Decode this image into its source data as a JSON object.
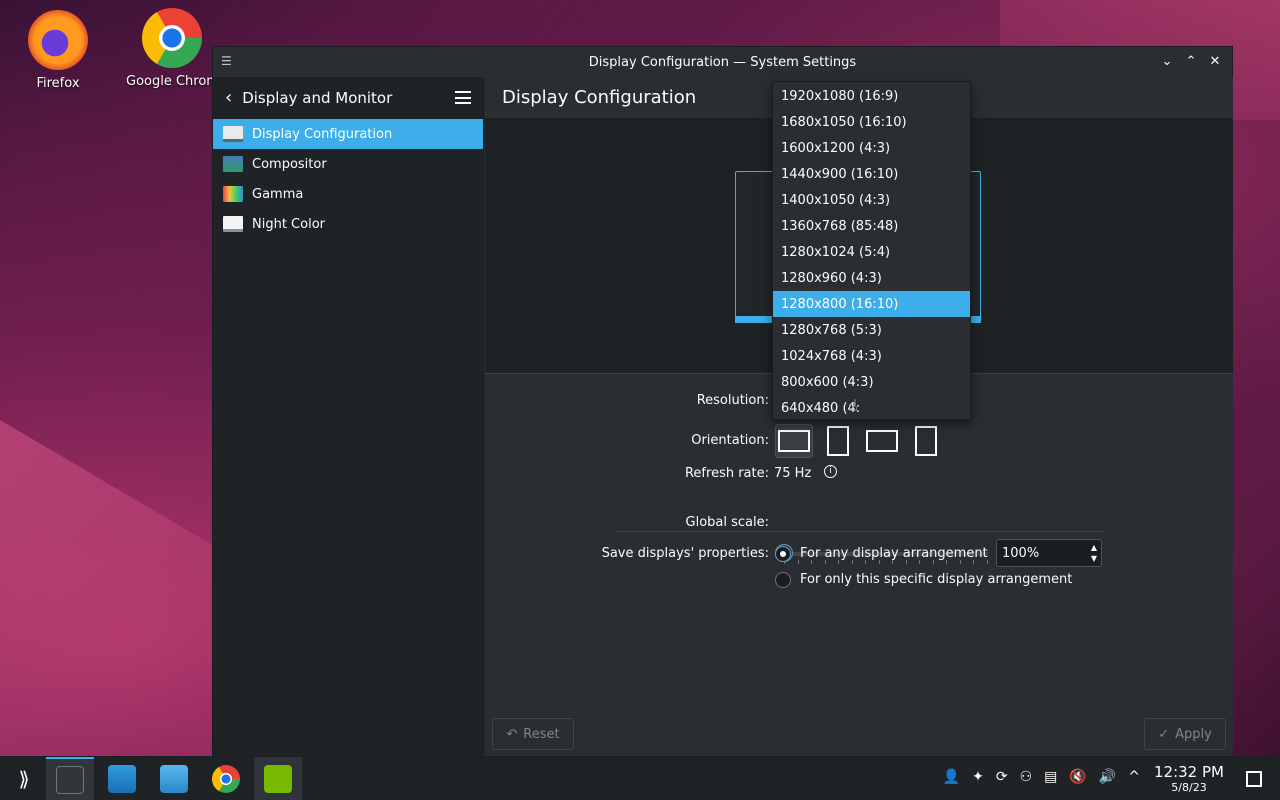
{
  "desktop": {
    "icons": [
      {
        "label": "Firefox"
      },
      {
        "label": "Google Chrome"
      }
    ]
  },
  "window": {
    "title": "Display Configuration — System Settings",
    "sidebar": {
      "header": "Display and Monitor",
      "items": [
        {
          "label": "Display Configuration",
          "icon": "display-icon",
          "active": true
        },
        {
          "label": "Compositor",
          "icon": "compositor-icon"
        },
        {
          "label": "Gamma",
          "icon": "gamma-icon"
        },
        {
          "label": "Night Color",
          "icon": "night-color-icon"
        }
      ]
    },
    "main": {
      "title": "Display Configuration",
      "resolution_label": "Resolution:",
      "orientation_label": "Orientation:",
      "refresh_label": "Refresh rate:",
      "refresh_value": "75 Hz",
      "global_scale_label": "Global scale:",
      "global_scale_value": "100%",
      "save_props_label": "Save displays' properties:",
      "save_options": [
        {
          "label": "For any display arrangement",
          "checked": true
        },
        {
          "label": "For only this specific display arrangement",
          "checked": false
        }
      ],
      "reset_label": "Reset",
      "apply_label": "Apply"
    },
    "resolution_dropdown": {
      "selected": "1280x800 (16:10)",
      "options": [
        "1920x1080 (16:9)",
        "1680x1050 (16:10)",
        "1600x1200 (4:3)",
        "1440x900 (16:10)",
        "1400x1050 (4:3)",
        "1360x768 (85:48)",
        "1280x1024 (5:4)",
        "1280x960 (4:3)",
        "1280x800 (16:10)",
        "1280x768 (5:3)",
        "1024x768 (4:3)",
        "800x600 (4:3)",
        "640x480 (4:"
      ]
    }
  },
  "taskbar": {
    "clock_time": "12:32 PM",
    "clock_date": "5/8/23"
  },
  "colors": {
    "accent": "#3daee9",
    "window_bg": "#2a2e32",
    "sidebar_bg": "#202326"
  }
}
